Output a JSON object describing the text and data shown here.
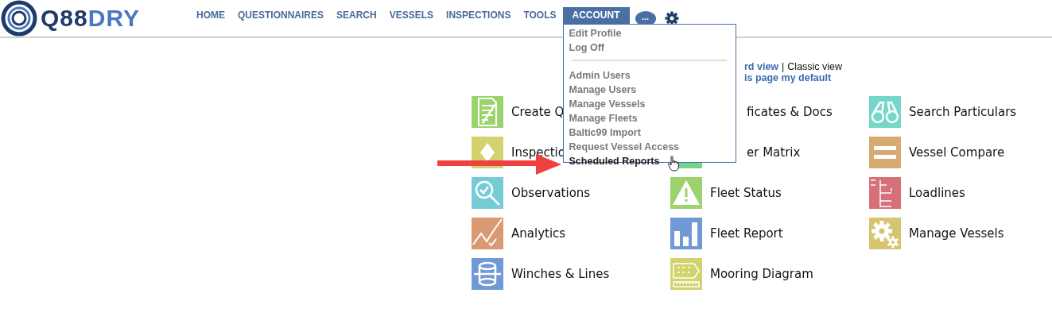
{
  "logo": {
    "parts": [
      "Q88",
      "DRY"
    ]
  },
  "nav": [
    {
      "label": "HOME",
      "selected": false
    },
    {
      "label": "QUESTIONNAIRES",
      "selected": false
    },
    {
      "label": "SEARCH",
      "selected": false
    },
    {
      "label": "VESSELS",
      "selected": false
    },
    {
      "label": "INSPECTIONS",
      "selected": false
    },
    {
      "label": "TOOLS",
      "selected": false
    },
    {
      "label": "ACCOUNT",
      "selected": true
    }
  ],
  "chat_button": {
    "label": "..."
  },
  "account_menu": [
    {
      "kind": "item",
      "label": "Edit Profile",
      "hovered": false
    },
    {
      "kind": "item",
      "label": "Log Off",
      "hovered": false
    },
    {
      "kind": "divider"
    },
    {
      "kind": "item",
      "label": "Admin Users",
      "hovered": false
    },
    {
      "kind": "item",
      "label": "Manage Users",
      "hovered": false
    },
    {
      "kind": "item",
      "label": "Manage Vessels",
      "hovered": false
    },
    {
      "kind": "item",
      "label": "Manage Fleets",
      "hovered": false
    },
    {
      "kind": "item",
      "label": "Baltic99 Import",
      "hovered": false
    },
    {
      "kind": "item",
      "label": "Request Vessel Access",
      "hovered": false
    },
    {
      "kind": "item",
      "label": "Scheduled Reports",
      "hovered": true
    }
  ],
  "view_switch": {
    "current": "rd view",
    "separator": "|",
    "other": "Classic view",
    "default_link": "is page my default"
  },
  "tiles": [
    {
      "kind": "document",
      "color": "#9dd36e",
      "label": "Create Q"
    },
    {
      "kind": "none",
      "label": "ficates & Docs",
      "hidden_start": true
    },
    {
      "kind": "binoculars",
      "color": "#76d6ca",
      "label": "Search Particulars"
    },
    {
      "kind": "diamond",
      "color": "#d3d36e",
      "label": "Inspectio"
    },
    {
      "kind": "partial",
      "color": "#77d38a",
      "label": "er Matrix",
      "hidden_start": true
    },
    {
      "kind": "equals",
      "color": "#d6ab73",
      "label": "Vessel Compare"
    },
    {
      "kind": "magnifier",
      "color": "#76ccd6",
      "label": "Observations"
    },
    {
      "kind": "warning",
      "color": "#9dd36e",
      "label": "Fleet Status"
    },
    {
      "kind": "loadline",
      "color": "#d6707a",
      "label": "Loadlines"
    },
    {
      "kind": "trend",
      "color": "#d99a73",
      "label": "Analytics"
    },
    {
      "kind": "bars",
      "color": "#7199d6",
      "label": "Fleet Report"
    },
    {
      "kind": "gears",
      "color": "#d6c46e",
      "label": "Manage Vessels"
    },
    {
      "kind": "winch",
      "color": "#7199d6",
      "label": "Winches & Lines"
    },
    {
      "kind": "diagram",
      "color": "#d3d36e",
      "label": "Mooring Diagram"
    }
  ]
}
